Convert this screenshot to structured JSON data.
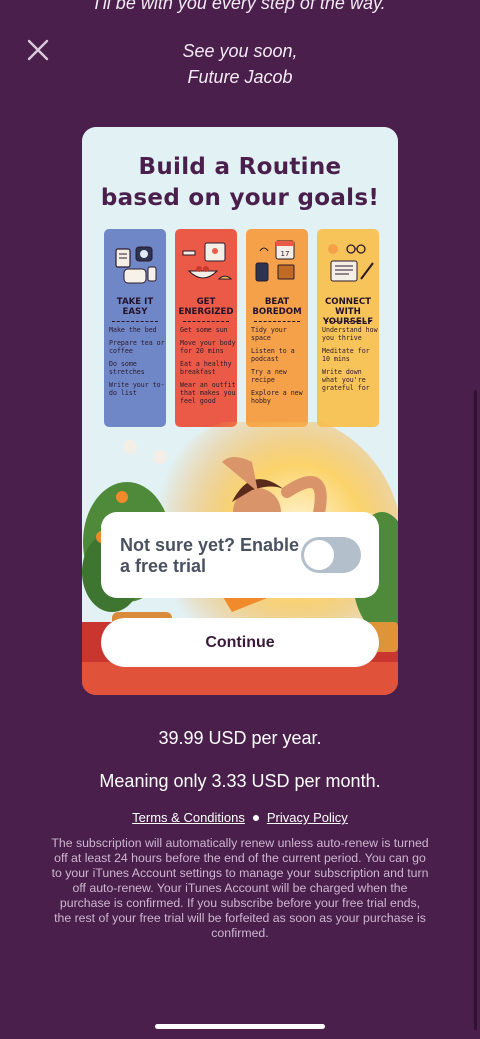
{
  "intro_line": "I'll be with you every step of the way.",
  "signoff": {
    "line1": "See you soon,",
    "line2": "Future Jacob"
  },
  "card": {
    "title_line1": "Build a Routine",
    "title_line2": "based on your goals!",
    "columns": [
      {
        "heading": "TAKE IT EASY",
        "color": "#6f86c7",
        "items": [
          "Make the bed",
          "Prepare tea or coffee",
          "Do some stretches",
          "Write your to-do list"
        ]
      },
      {
        "heading": "GET ENERGIZED",
        "color": "#ea5a47",
        "items": [
          "Get some sun",
          "Move your body for 20 mins",
          "Eat a healthy breakfast",
          "Wear an outfit that makes you feel good"
        ]
      },
      {
        "heading": "BEAT BOREDOM",
        "color": "#f5a14a",
        "items": [
          "Tidy your space",
          "Listen to a podcast",
          "Try a new recipe",
          "Explore a new hobby"
        ]
      },
      {
        "heading": "CONNECT WITH YOURSELF",
        "color": "#f7c45a",
        "items": [
          "Understand how you thrive",
          "Meditate for 10 mins",
          "Write down what you're grateful for"
        ]
      }
    ]
  },
  "trial": {
    "label": "Not sure yet? Enable a free trial",
    "enabled": false
  },
  "continue_label": "Continue",
  "pricing": {
    "yearly": "39.99 USD per year.",
    "monthly": "Meaning only 3.33 USD per month."
  },
  "links": {
    "terms": "Terms & Conditions",
    "privacy": "Privacy Policy"
  },
  "legal_text": "The subscription will automatically renew unless auto-renew is turned off at least 24 hours before the end of the current period. You can go to your iTunes Account settings to manage your subscription and turn off auto-renew. Your iTunes Account will be charged when the purchase is confirmed. If you subscribe before your free trial ends, the rest of your free trial will be forfeited as soon as your purchase is confirmed.",
  "colors": {
    "background": "#4a1f4c",
    "card_sky": "#e2f1f4",
    "toggle_off": "#b4bfcc"
  },
  "icons": {
    "close": "close-icon"
  }
}
